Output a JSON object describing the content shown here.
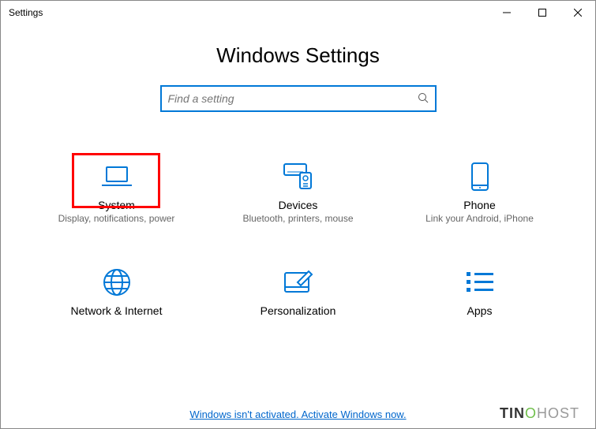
{
  "window": {
    "title": "Settings"
  },
  "page": {
    "heading": "Windows Settings"
  },
  "search": {
    "placeholder": "Find a setting"
  },
  "tiles": [
    {
      "title": "System",
      "desc": "Display, notifications, power"
    },
    {
      "title": "Devices",
      "desc": "Bluetooth, printers, mouse"
    },
    {
      "title": "Phone",
      "desc": "Link your Android, iPhone"
    },
    {
      "title": "Network & Internet",
      "desc": ""
    },
    {
      "title": "Personalization",
      "desc": ""
    },
    {
      "title": "Apps",
      "desc": ""
    }
  ],
  "footer": {
    "activate": "Windows isn't activated. Activate Windows now."
  },
  "watermark": {
    "part1": "TIN",
    "o": "O",
    "part2": "HOST"
  }
}
